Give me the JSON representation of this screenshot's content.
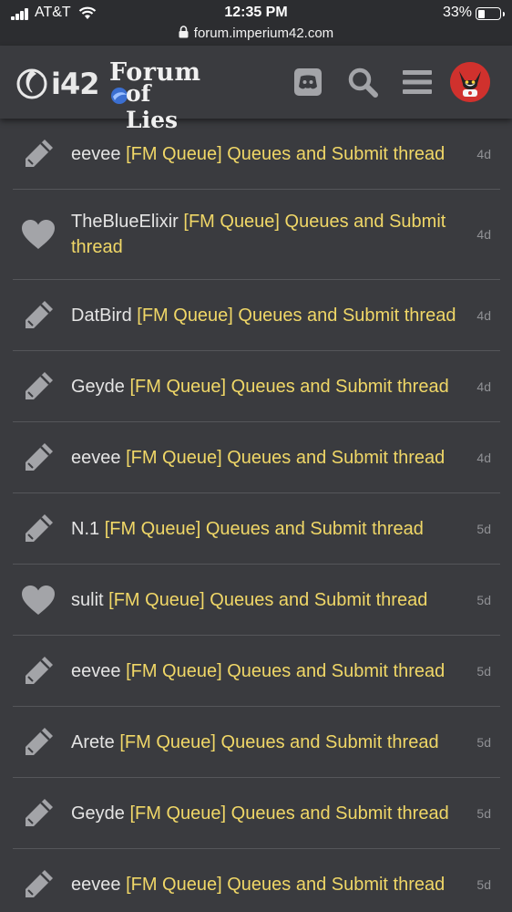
{
  "status_bar": {
    "carrier": "AT&T",
    "time": "12:35 PM",
    "battery": "33%",
    "battery_level": 0.33,
    "url": "forum.imperium42.com"
  },
  "header": {
    "logo_left": "i42",
    "logo_title_1": "Forum",
    "logo_title_2": "of Lies",
    "icons": [
      "discord-icon",
      "search-icon",
      "hamburger-menu-icon",
      "avatar"
    ]
  },
  "notifications": [
    {
      "icon": "pencil-icon",
      "user": "eevee",
      "topic": "[FM Queue] Queues and Submit thread",
      "age": "4d"
    },
    {
      "icon": "heart-icon",
      "user": "TheBlueElixir",
      "topic": "[FM Queue] Queues and Submit thread",
      "age": "4d"
    },
    {
      "icon": "pencil-icon",
      "user": "DatBird",
      "topic": "[FM Queue] Queues and Submit thread",
      "age": "4d"
    },
    {
      "icon": "pencil-icon",
      "user": "Geyde",
      "topic": "[FM Queue] Queues and Submit thread",
      "age": "4d"
    },
    {
      "icon": "pencil-icon",
      "user": "eevee",
      "topic": "[FM Queue] Queues and Submit thread",
      "age": "4d"
    },
    {
      "icon": "pencil-icon",
      "user": "N.1",
      "topic": "[FM Queue] Queues and Submit thread",
      "age": "5d"
    },
    {
      "icon": "heart-icon",
      "user": "sulit",
      "topic": "[FM Queue] Queues and Submit thread",
      "age": "5d"
    },
    {
      "icon": "pencil-icon",
      "user": "eevee",
      "topic": "[FM Queue] Queues and Submit thread",
      "age": "5d"
    },
    {
      "icon": "pencil-icon",
      "user": "Arete",
      "topic": "[FM Queue] Queues and Submit thread",
      "age": "5d"
    },
    {
      "icon": "pencil-icon",
      "user": "Geyde",
      "topic": "[FM Queue] Queues and Submit thread",
      "age": "5d"
    },
    {
      "icon": "pencil-icon",
      "user": "eevee",
      "topic": "[FM Queue] Queues and Submit thread",
      "age": "5d"
    }
  ],
  "colors": {
    "background": "#3a3b3f",
    "topic": "#f0d767",
    "username": "#e4e4e4",
    "age": "#909195",
    "icon": "#a3a4a8",
    "avatar_bg": "#d0312d"
  }
}
